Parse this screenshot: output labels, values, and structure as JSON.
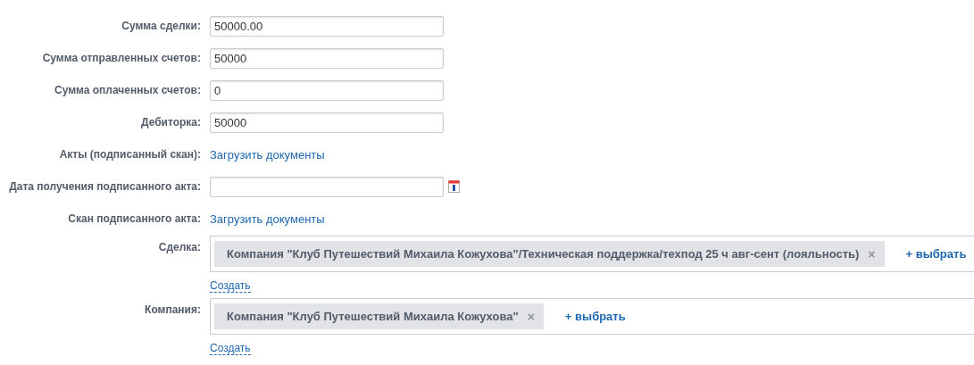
{
  "fields": [
    {
      "kind": "input",
      "label": "Сумма сделки:",
      "value": "50000.00"
    },
    {
      "kind": "input",
      "label": "Сумма отправленных счетов:",
      "value": "50000"
    },
    {
      "kind": "input",
      "label": "Сумма оплаченных счетов:",
      "value": "0"
    },
    {
      "kind": "input",
      "label": "Дебиторка:",
      "value": "50000"
    },
    {
      "kind": "link",
      "label": "Акты (подписанный скан):",
      "link": "Загрузить документы"
    },
    {
      "kind": "date",
      "label": "Дата получения подписанного акта:"
    },
    {
      "kind": "link",
      "label": "Скан подписанного акта:",
      "link": "Загрузить документы"
    },
    {
      "kind": "entity",
      "label": "Сделка:",
      "tags": [
        "Компания \"Клуб Путешествий Михаила Кожухова\"/Техническая поддержка/техпод 25 ч авг-сент (лояльность)"
      ],
      "remove": "×",
      "add": "+ выбрать",
      "create": "Создать"
    },
    {
      "kind": "entity",
      "label": "Компания:",
      "tags": [
        "Компания \"Клуб Путешествий Михаила Кожухова\""
      ],
      "remove": "×",
      "add": "+ выбрать",
      "create": "Создать"
    }
  ]
}
